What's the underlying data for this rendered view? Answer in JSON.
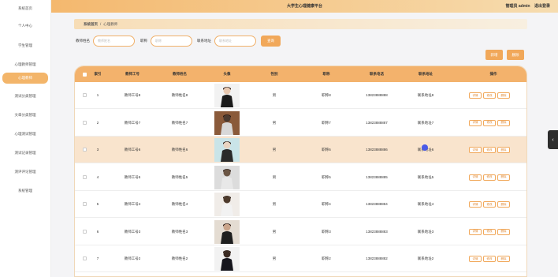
{
  "app": {
    "title": "大学生心理健康平台",
    "user_role": "管理员 admin",
    "logout": "退出登录"
  },
  "sidebar": {
    "items": [
      {
        "label": "系统首页",
        "active": false
      },
      {
        "label": "个人中心",
        "active": false
      },
      {
        "label": "学生管理",
        "active": false
      },
      {
        "label": "心理教师管理",
        "active": false
      },
      {
        "label": "心理教师",
        "active": true
      },
      {
        "label": "测试分类管理",
        "active": false
      },
      {
        "label": "文章分类管理",
        "active": false
      },
      {
        "label": "心理测试管理",
        "active": false
      },
      {
        "label": "测试记录管理",
        "active": false
      },
      {
        "label": "测评评论管理",
        "active": false
      },
      {
        "label": "系统管理",
        "active": false
      }
    ]
  },
  "breadcrumb": {
    "home": "系统首页",
    "sep": "/",
    "current": "心理教师"
  },
  "search": {
    "teacher_name_label": "教师姓名",
    "teacher_name_placeholder": "教师姓名",
    "title_label": "职称",
    "title_placeholder": "职称",
    "contact_label": "联系地址",
    "contact_placeholder": "联系地址",
    "query_button": "查询"
  },
  "actions": {
    "add": "新增",
    "delete": "删除"
  },
  "table": {
    "headers": [
      "索引",
      "教师工号",
      "教师姓名",
      "头像",
      "性别",
      "职称",
      "联系电话",
      "联系地址",
      "操作"
    ],
    "op_labels": [
      "详情",
      "修改",
      "删除"
    ],
    "rows": [
      {
        "index": "1",
        "teacher_no": "教师工号8",
        "name": "教师姓名8",
        "gender": "男",
        "title": "职称8",
        "phone": "13823888888",
        "address": "联系地址8"
      },
      {
        "index": "2",
        "teacher_no": "教师工号7",
        "name": "教师姓名7",
        "gender": "男",
        "title": "职称7",
        "phone": "13823888887",
        "address": "联系地址7"
      },
      {
        "index": "3",
        "teacher_no": "教师工号6",
        "name": "教师姓名6",
        "gender": "男",
        "title": "职称6",
        "phone": "13823888886",
        "address": "联系地址6"
      },
      {
        "index": "4",
        "teacher_no": "教师工号5",
        "name": "教师姓名5",
        "gender": "男",
        "title": "职称5",
        "phone": "13823888885",
        "address": "联系地址5"
      },
      {
        "index": "5",
        "teacher_no": "教师工号4",
        "name": "教师姓名4",
        "gender": "男",
        "title": "职称4",
        "phone": "13823888884",
        "address": "联系地址4"
      },
      {
        "index": "6",
        "teacher_no": "教师工号3",
        "name": "教师姓名3",
        "gender": "男",
        "title": "职称3",
        "phone": "13823888883",
        "address": "联系地址3"
      },
      {
        "index": "7",
        "teacher_no": "教师工号2",
        "name": "教师姓名2",
        "gender": "男",
        "title": "职称2",
        "phone": "13823888882",
        "address": "联系地址2"
      }
    ]
  },
  "edge_tab_icon": "chevron-left-icon"
}
